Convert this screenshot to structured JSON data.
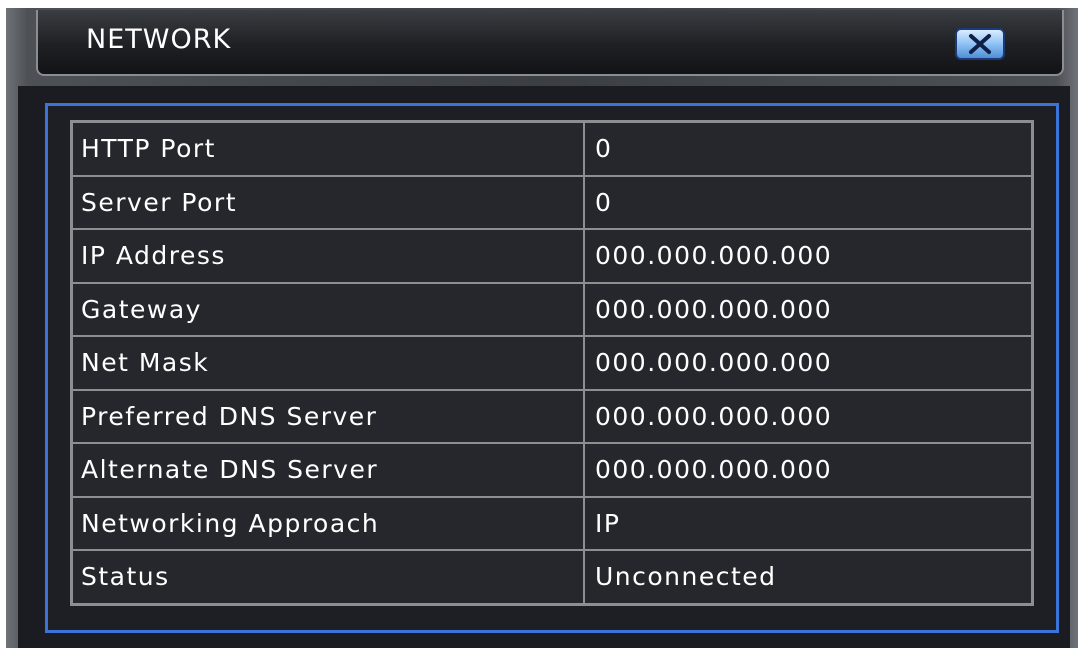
{
  "window": {
    "title": "NETWORK",
    "close_icon": "close-x-icon"
  },
  "settings": [
    {
      "label": "HTTP Port",
      "value": "0"
    },
    {
      "label": "Server Port",
      "value": "0"
    },
    {
      "label": "IP Address",
      "value": "000.000.000.000"
    },
    {
      "label": "Gateway",
      "value": "000.000.000.000"
    },
    {
      "label": "Net Mask",
      "value": "000.000.000.000"
    },
    {
      "label": "Preferred DNS Server",
      "value": "000.000.000.000"
    },
    {
      "label": "Alternate DNS Server",
      "value": "000.000.000.000"
    },
    {
      "label": "Networking Approach",
      "value": "IP"
    },
    {
      "label": "Status",
      "value": "Unconnected"
    }
  ],
  "colors": {
    "frame_accent": "#3b74d8",
    "panel_background": "#1d1f24",
    "text": "#ffffff"
  }
}
